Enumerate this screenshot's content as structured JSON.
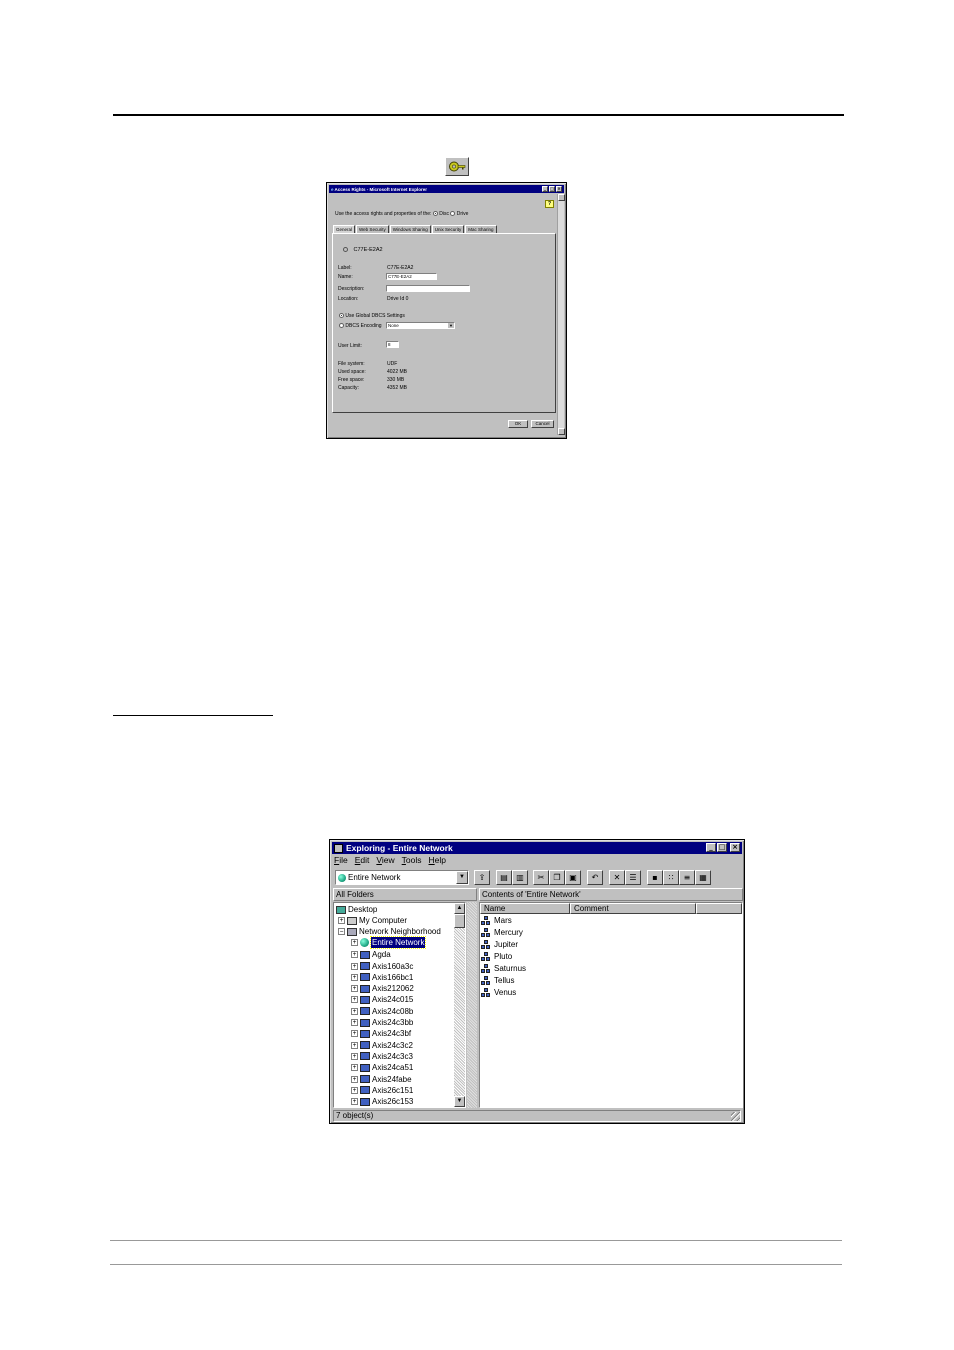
{
  "dialog": {
    "title": "Access Rights - Microsoft Internet Explorer",
    "intro": "Use the access rights and properties of the:",
    "radio_disc": "Disc",
    "radio_drive": "Drive",
    "tabs": [
      "General",
      "Web Security",
      "Windows Sharing",
      "Unix Security",
      "Mac Sharing"
    ],
    "disc_name": "C77E-E2A2",
    "fields": {
      "label_label": "Label:",
      "label_value": "C77E-E2A2",
      "name_label": "Name:",
      "name_value": "C77E-E2A2",
      "description_label": "Description:",
      "description_value": "",
      "location_label": "Location:",
      "location_value": "Drive Id 0"
    },
    "global_dbcs": "Use Global DBCS Settings",
    "dbcs_encoding": "DBCS Encoding",
    "dbcs_value": "None",
    "user_limit_label": "User Limit:",
    "user_limit_value": "8",
    "stats": {
      "fs_label": "File system:",
      "fs_value": "UDF",
      "used_label": "Used space:",
      "used_value": "4022 MB",
      "free_label": "Free space:",
      "free_value": "330 MB",
      "cap_label": "Capacity:",
      "cap_value": "4352 MB"
    },
    "ok": "OK",
    "cancel": "Cancel",
    "help_glyph": "?"
  },
  "explorer": {
    "title": "Exploring - Entire Network",
    "menu": [
      "File",
      "Edit",
      "View",
      "Tools",
      "Help"
    ],
    "address": "Entire Network",
    "all_folders": "All Folders",
    "contents_header": "Contents of 'Entire Network'",
    "columns": [
      "Name",
      "Comment"
    ],
    "tree": [
      "Desktop",
      "My Computer",
      "Network Neighborhood",
      "Entire Network",
      "Agda",
      "Axis160a3c",
      "Axis166bc1",
      "Axis212062",
      "Axis24c015",
      "Axis24c08b",
      "Axis24c3bb",
      "Axis24c3bf",
      "Axis24c3c2",
      "Axis24c3c3",
      "Axis24ca51",
      "Axis24fabe",
      "Axis26c151",
      "Axis26c153"
    ],
    "items": [
      "Mars",
      "Mercury",
      "Jupiter",
      "Pluto",
      "Saturnus",
      "Tellus",
      "Venus"
    ],
    "status": "7 object(s)"
  },
  "window_buttons": {
    "minimize": "_",
    "maximize": "□",
    "close": "×"
  },
  "colors": {
    "titlebar": "#000080",
    "chrome": "#c0c0c0",
    "selection": "#000080"
  }
}
